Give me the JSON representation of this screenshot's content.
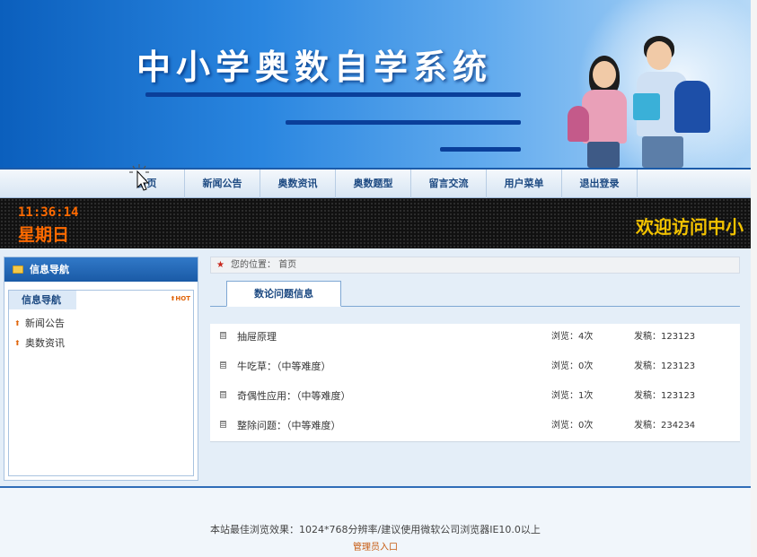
{
  "site": {
    "title": "中小学奥数自学系统"
  },
  "nav": {
    "items": [
      {
        "label": "首页"
      },
      {
        "label": "新闻公告"
      },
      {
        "label": "奥数资讯"
      },
      {
        "label": "奥数题型"
      },
      {
        "label": "留言交流"
      },
      {
        "label": "用户菜单"
      },
      {
        "label": "退出登录"
      }
    ]
  },
  "led": {
    "time": "11:36:14",
    "day": "星期日",
    "welcome": "欢迎访问中小"
  },
  "sidebar": {
    "header": "信息导航",
    "tab": "信息导航",
    "hot_badge": "HOT",
    "links": [
      {
        "label": "新闻公告"
      },
      {
        "label": "奥数资讯"
      }
    ]
  },
  "breadcrumb": {
    "prefix": "您的位置：",
    "current": "首页"
  },
  "main": {
    "tab_label": "数论问题信息",
    "rows": [
      {
        "title": "抽屉原理",
        "views": "浏览：4次",
        "author": "发稿：123123"
      },
      {
        "title": "牛吃草：（中等难度）",
        "views": "浏览：0次",
        "author": "发稿：123123"
      },
      {
        "title": "奇偶性应用：（中等难度）",
        "views": "浏览：1次",
        "author": "发稿：123123"
      },
      {
        "title": "整除问题：（中等难度）",
        "views": "浏览：0次",
        "author": "发稿：234234"
      }
    ]
  },
  "footer": {
    "info": "本站最佳浏览效果：1024*768分辨率/建议使用微软公司浏览器IE10.0以上",
    "admin_link": "管理员入口"
  }
}
